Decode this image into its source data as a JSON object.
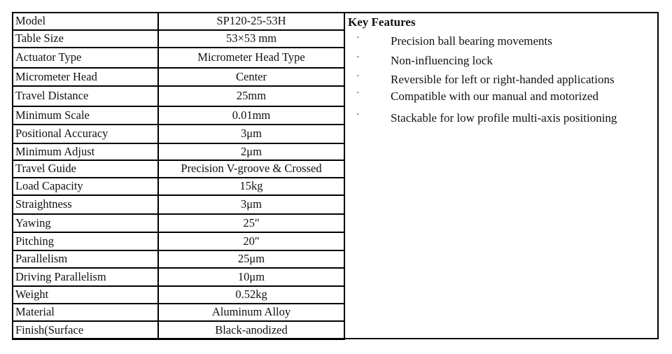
{
  "specs": [
    {
      "label": "Model",
      "value": "SP120-25-53H"
    },
    {
      "label": "Table Size",
      "value": "53×53 mm"
    },
    {
      "label": "Actuator Type",
      "value": "Micrometer Head Type"
    },
    {
      "label": "Micrometer Head",
      "value": "Center"
    },
    {
      "label": "Travel Distance",
      "value": "25mm"
    },
    {
      "label": "Minimum Scale",
      "value": "0.01mm"
    },
    {
      "label": "Positional  Accuracy",
      "value": "3μm"
    },
    {
      "label": "Minimum Adjust",
      "value": "2μm"
    },
    {
      "label": "Travel Guide",
      "value": "Precision V-groove & Crossed"
    },
    {
      "label": "Load Capacity",
      "value": "15kg"
    },
    {
      "label": "Straightness",
      "value": "3μm"
    },
    {
      "label": "Yawing",
      "value": "25″"
    },
    {
      "label": "Pitching",
      "value": "20″"
    },
    {
      "label": "Parallelism",
      "value": "25μm"
    },
    {
      "label": "Driving Parallelism",
      "value": "10μm"
    },
    {
      "label": "Weight",
      "value": "0.52kg"
    },
    {
      "label": "Material",
      "value": "Aluminum Alloy"
    },
    {
      "label": "Finish(Surface",
      "value": "Black-anodized"
    }
  ],
  "features": {
    "title": "Key Features",
    "bullet": "·",
    "items": [
      "Precision ball bearing movements",
      "Non-influencing lock",
      "Reversible for left or right-handed applications",
      "Compatible with our manual and motorized",
      "Stackable for low profile multi-axis positioning"
    ]
  }
}
